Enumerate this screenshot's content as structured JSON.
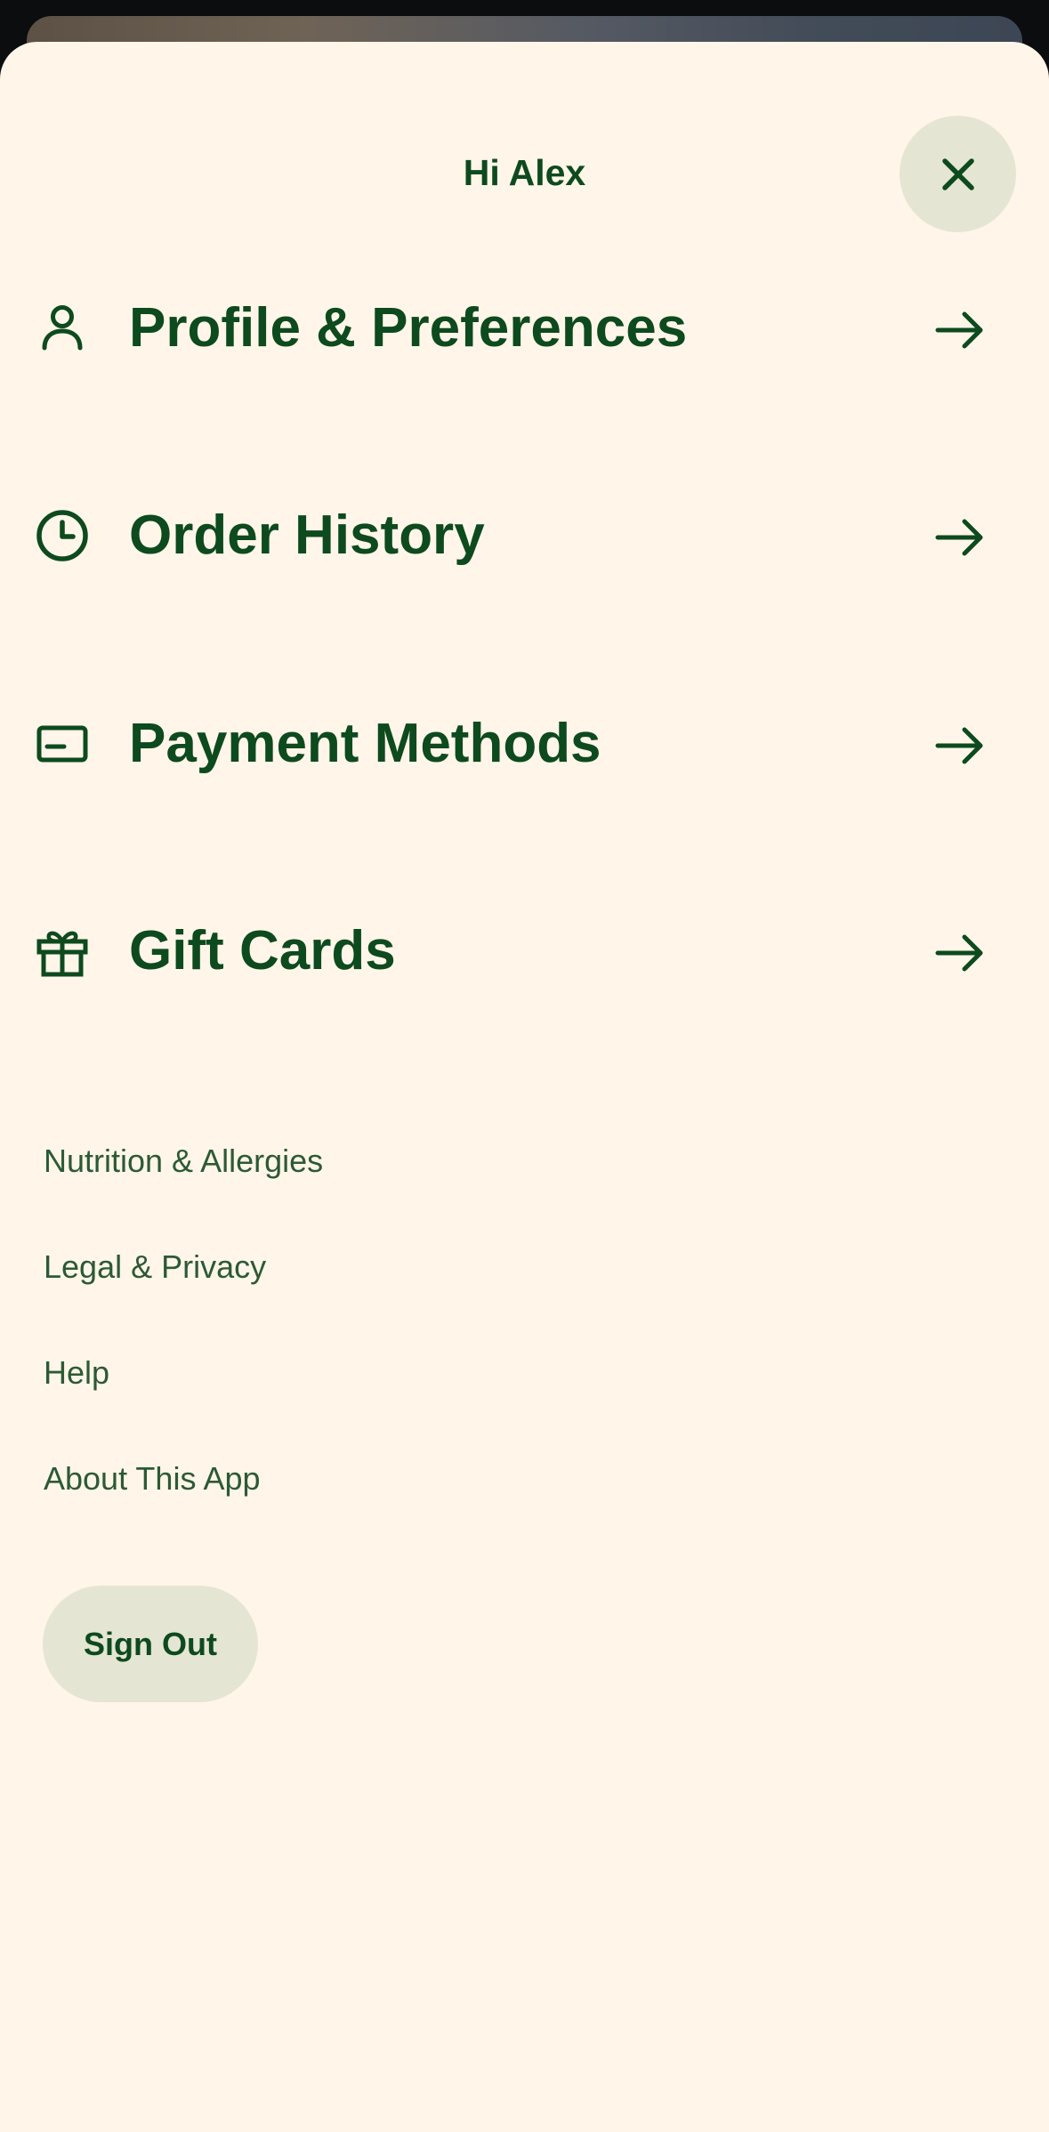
{
  "header": {
    "greeting": "Hi Alex",
    "close_icon": "close-icon"
  },
  "menu": {
    "items": [
      {
        "label": "Profile & Preferences",
        "icon": "person-icon"
      },
      {
        "label": "Order History",
        "icon": "clock-icon"
      },
      {
        "label": "Payment Methods",
        "icon": "credit-card-icon"
      },
      {
        "label": "Gift Cards",
        "icon": "gift-icon"
      }
    ],
    "arrow_icon": "arrow-right-icon"
  },
  "links": [
    {
      "label": "Nutrition & Allergies"
    },
    {
      "label": "Legal & Privacy"
    },
    {
      "label": "Help"
    },
    {
      "label": "About This App"
    }
  ],
  "sign_out_label": "Sign Out",
  "colors": {
    "sheet_background": "#fff5e9",
    "primary_text": "#0d4a1e",
    "secondary_text": "#2c5a35",
    "button_background": "#e5e5d4"
  }
}
